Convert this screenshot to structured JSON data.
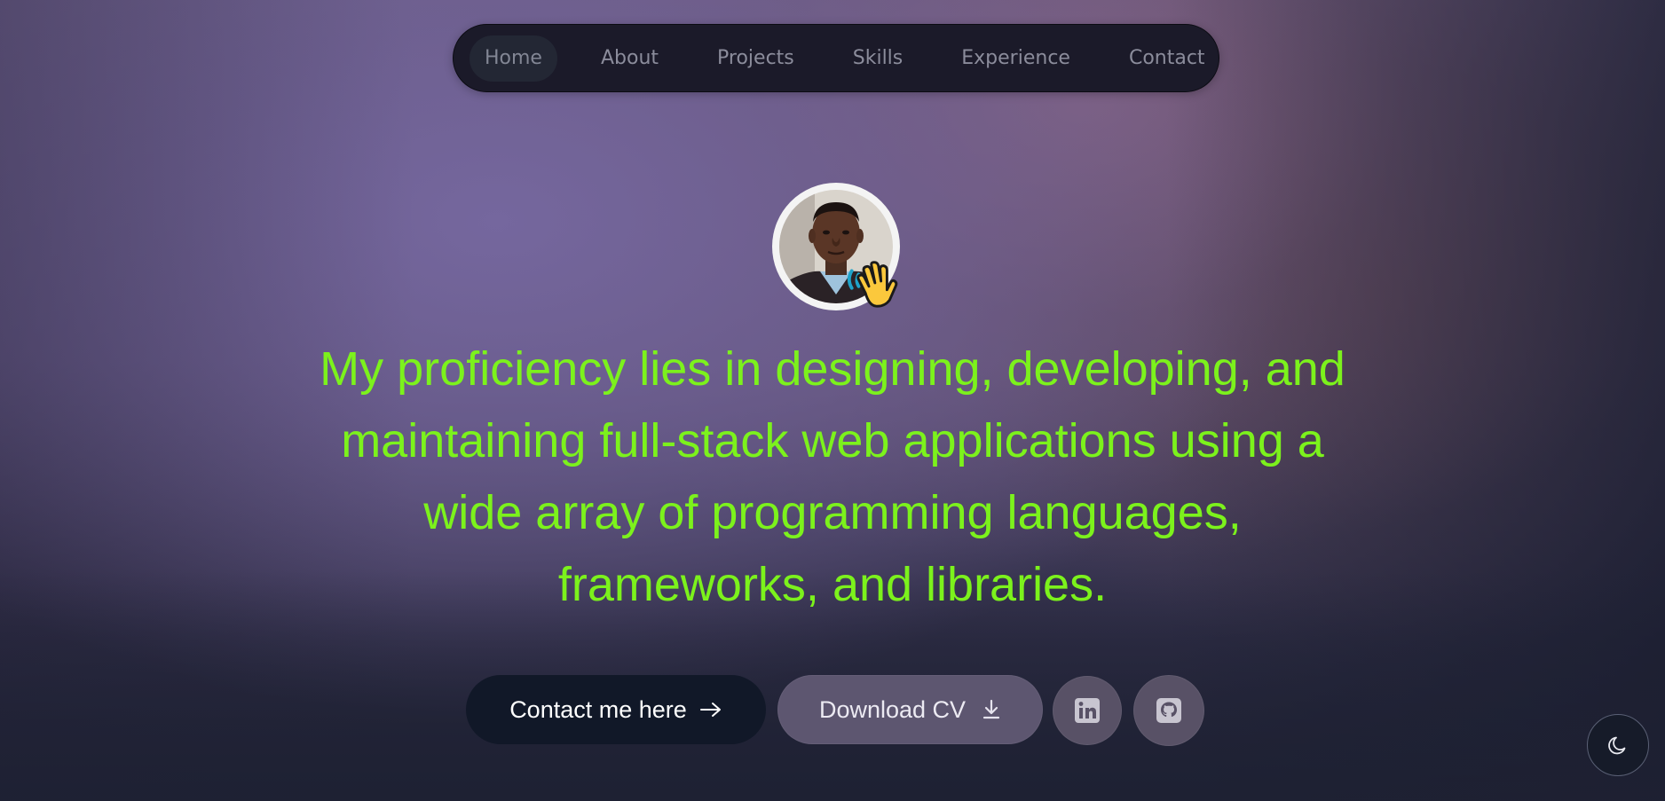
{
  "nav": {
    "items": [
      {
        "label": "Home",
        "active": true
      },
      {
        "label": "About",
        "active": false
      },
      {
        "label": "Projects",
        "active": false
      },
      {
        "label": "Skills",
        "active": false
      },
      {
        "label": "Experience",
        "active": false
      },
      {
        "label": "Contact",
        "active": false
      }
    ]
  },
  "hero": {
    "avatar": {
      "icon": "profile-photo",
      "badge_icon": "waving-hand-emoji"
    },
    "headline": "My proficiency lies in designing, developing, and maintaining full-stack web applications using a wide array of programming languages, frameworks, and libraries."
  },
  "actions": {
    "contact_label": "Contact me here",
    "contact_icon": "arrow-right-icon",
    "cv_label": "Download CV",
    "cv_icon": "download-icon",
    "linkedin_icon": "linkedin-icon",
    "github_icon": "github-icon"
  },
  "theme_toggle": {
    "icon": "moon-icon"
  },
  "colors": {
    "headline": "#7cf21c",
    "nav_bg": "#1b1a29",
    "contact_button_bg": "#111828",
    "cv_button_bg": "#5d5670"
  }
}
